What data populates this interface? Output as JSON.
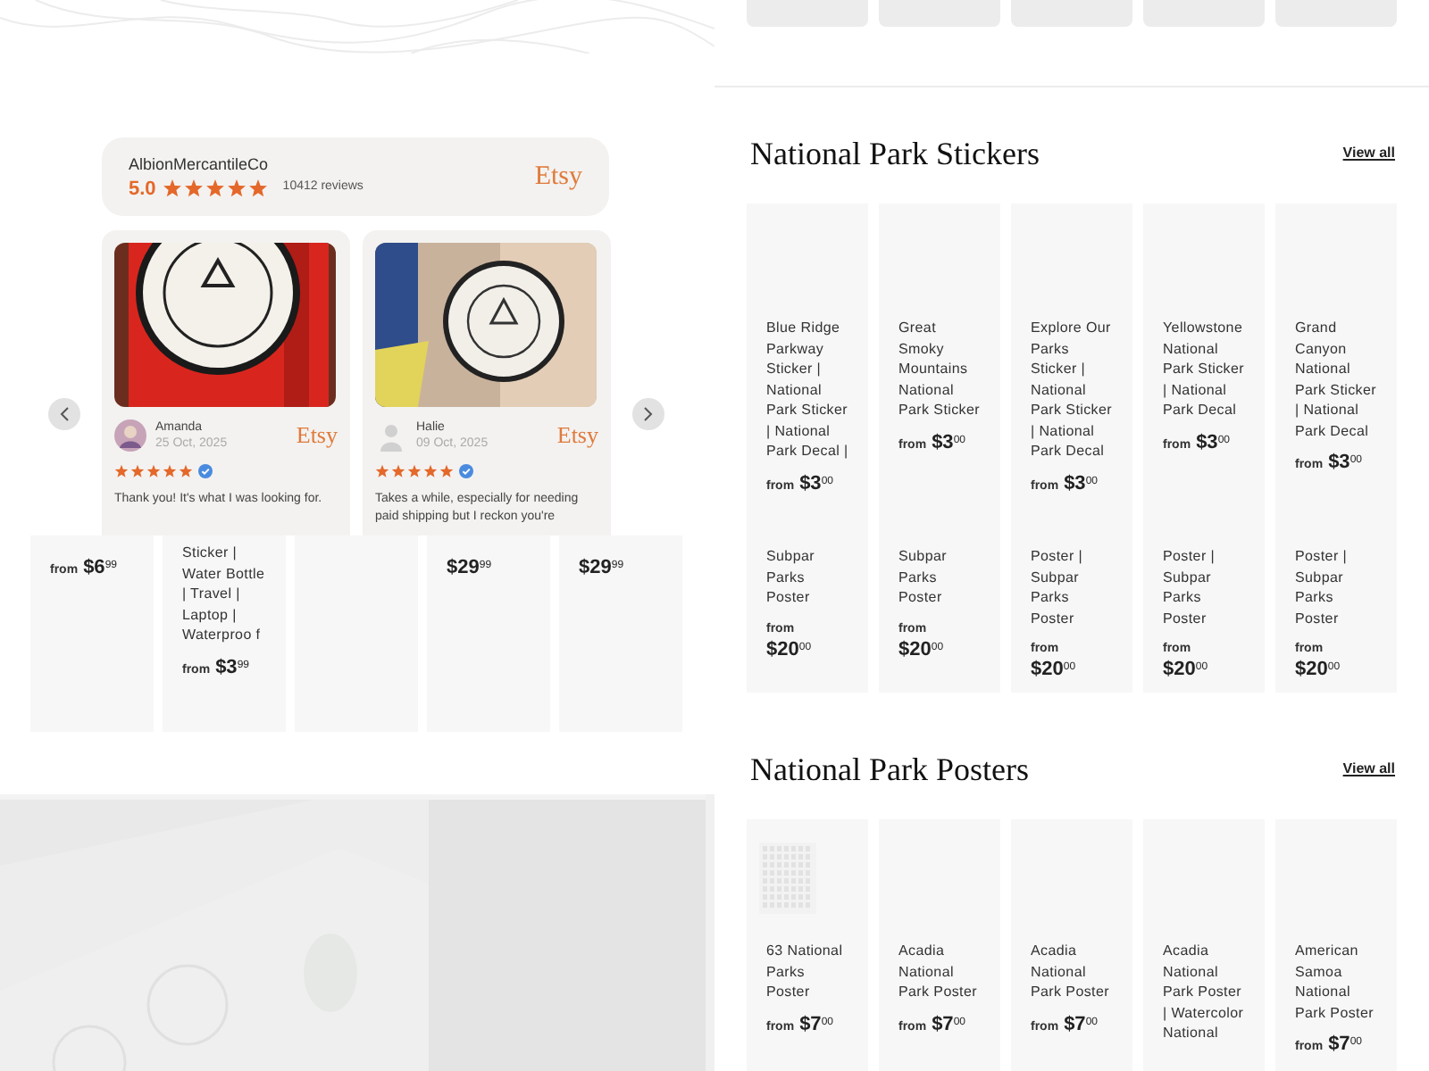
{
  "shop_reviews": {
    "shop_name": "AlbionMercantileCo",
    "rating": "5.0",
    "stars": 5,
    "review_count": "10412 reviews",
    "platform": "Etsy",
    "reviews": [
      {
        "name": "Amanda",
        "date": "25 Oct, 2025",
        "platform": "Etsy",
        "stars": 5,
        "verified": true,
        "text": "Thank you! It's what I was looking for."
      },
      {
        "name": "Halie",
        "date": "09 Oct, 2025",
        "platform": "Etsy",
        "stars": 5,
        "verified": true,
        "text": "Takes a while, especially for needing paid shipping but I reckon you're"
      }
    ]
  },
  "left_products": [
    {
      "from": "from",
      "price": "$6$^{99}$"
    },
    {
      "title": "Sticker | Water Bottle | Travel | Laptop | Waterproo f",
      "from": "from",
      "price": "$3$^{99}$"
    },
    {
      "price": "$29$^{99}$"
    },
    {
      "price": "$29$^{99}$"
    }
  ],
  "stickers": {
    "title": "National Park Stickers",
    "link": "View all",
    "products": [
      {
        "title": "Blue Ridge Parkway Sticker | National Park Sticker | National Park Decal |",
        "from": "from",
        "price": "$3$^{00}$"
      },
      {
        "title": "Great Smoky Mountains National Park Sticker",
        "from": "from",
        "price": "$3$^{00}$"
      },
      {
        "title": "Explore Our Parks Sticker | National Park Sticker | National Park Decal",
        "from": "from",
        "price": "$3$^{00}$"
      },
      {
        "title": "Yellowstone National Park Sticker | National Park Decal",
        "from": "from",
        "price": "$3$^{00}$"
      },
      {
        "title": "Grand Canyon National Park Sticker | National Park Decal",
        "from": "from",
        "price": "$3$^{00}$"
      }
    ]
  },
  "poster_row": [
    {
      "title": "Subpar Parks Poster",
      "from": "from",
      "price": "$20$^{00}$"
    },
    {
      "title": "Subpar Parks Poster",
      "from": "from",
      "price": "$20$^{00}$"
    },
    {
      "title": "Poster | Subpar Parks Poster",
      "from": "from",
      "price": "$20$^{00}$"
    },
    {
      "title": "Poster | Subpar Parks Poster",
      "from": "from",
      "price": "$20$^{00}$"
    },
    {
      "title": "Poster | Subpar Parks Poster",
      "from": "from",
      "price": "$20$^{00}$"
    }
  ],
  "posters": {
    "title": "National Park Posters",
    "link": "View all",
    "products": [
      {
        "kind": "picture",
        "title": "63 National Parks Poster",
        "from": "from",
        "price": "$7$^{00}$"
      },
      {
        "title": "Acadia National Park Poster",
        "from": "from",
        "price": "$7$^{00}$"
      },
      {
        "title": "Acadia National Park Poster",
        "from": "from",
        "price": "$7$^{00}$"
      },
      {
        "title": "Acadia National Park Poster | Watercolor National"
      },
      {
        "title": "American Samoa National Park Poster",
        "from": "from",
        "price": "$7$^{00}$"
      }
    ]
  }
}
